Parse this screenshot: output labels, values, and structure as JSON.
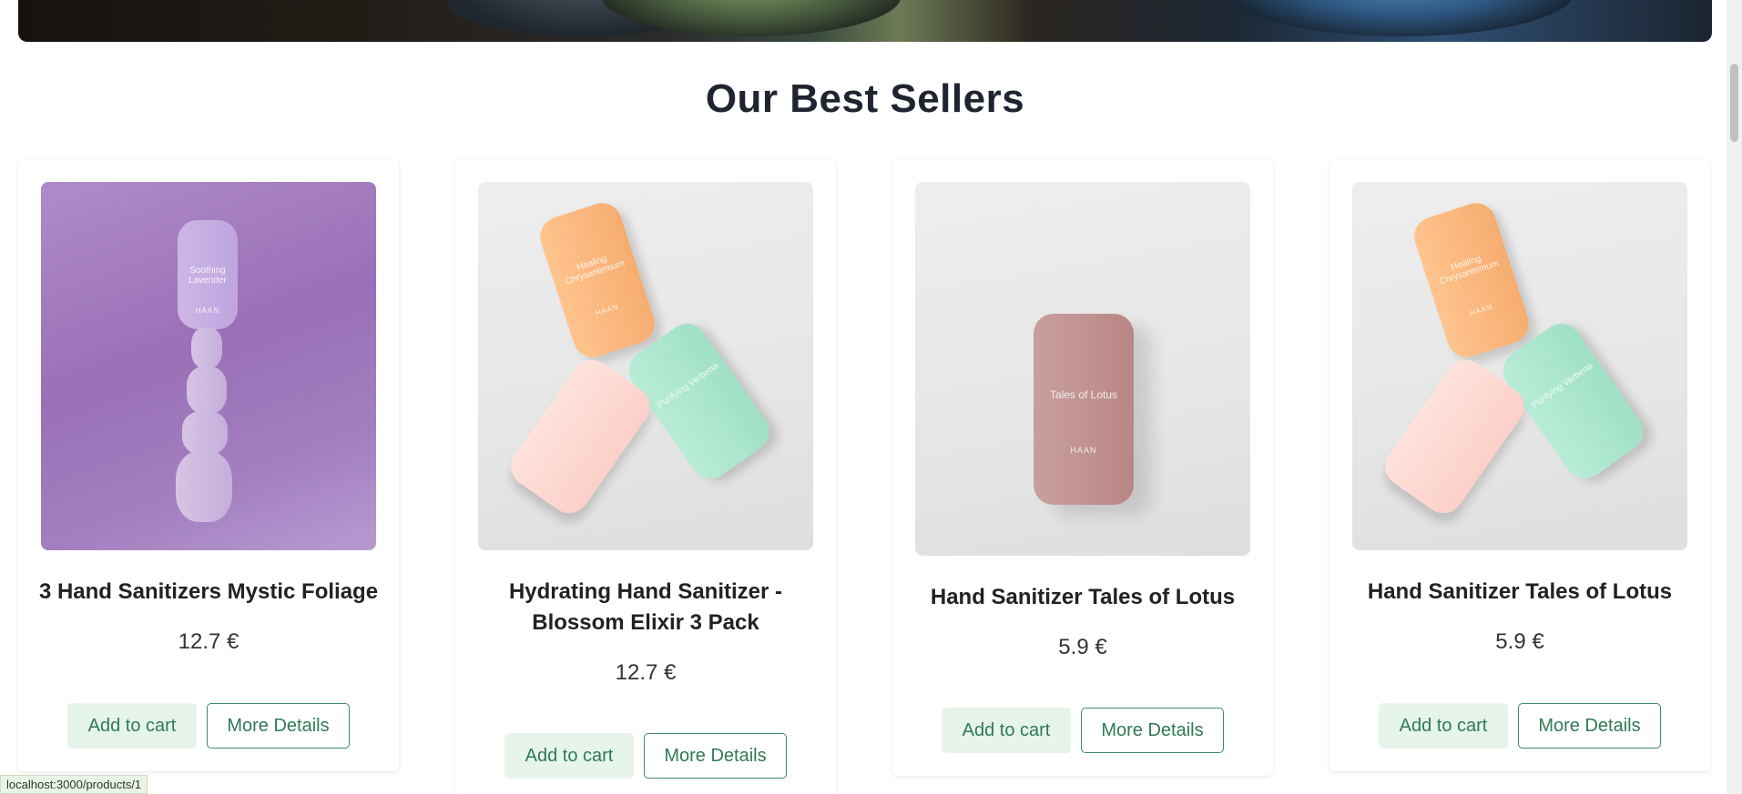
{
  "section": {
    "title": "Our Best Sellers"
  },
  "products": [
    {
      "name": "3 Hand Sanitizers Mystic Foliage",
      "price": "12.7 €",
      "add_label": "Add to cart",
      "details_label": "More Details",
      "image_alt": "Soothing Lavender"
    },
    {
      "name": "Hydrating Hand Sanitizer - Blossom Elixir 3 Pack",
      "price": "12.7 €",
      "add_label": "Add to cart",
      "details_label": "More Details"
    },
    {
      "name": "Hand Sanitizer Tales of Lotus",
      "price": "5.9 €",
      "add_label": "Add to cart",
      "details_label": "More Details",
      "image_alt": "Tales of Lotus"
    },
    {
      "name": "Hand Sanitizer Tales of Lotus",
      "price": "5.9 €",
      "add_label": "Add to cart",
      "details_label": "More Details"
    }
  ],
  "status": {
    "url": "localhost:3000/products/1"
  },
  "bottle_labels": {
    "lavender": "Soothing Lavender",
    "brand": "HAAN",
    "lotus": "Tales of Lotus",
    "chrys": "Healing Chrysantemum",
    "verbena": "Purifying Verbena"
  },
  "colors": {
    "accent": "#2f7a56",
    "cart_bg": "#e7f4ea"
  }
}
